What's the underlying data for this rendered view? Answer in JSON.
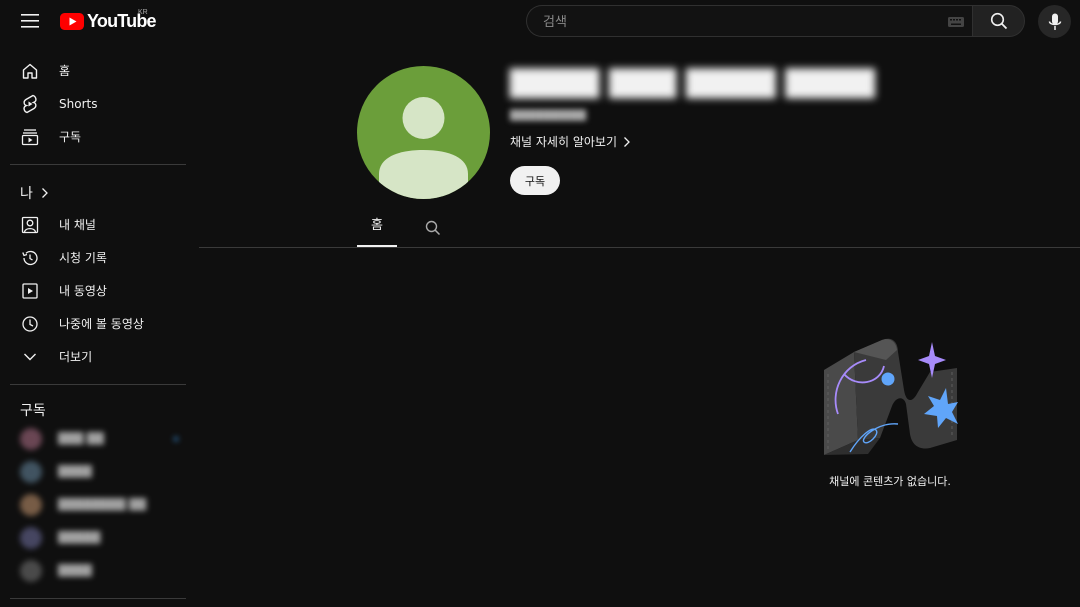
{
  "header": {
    "logo_text": "YouTube",
    "region": "KR",
    "search_placeholder": "검색"
  },
  "sidebar": {
    "main_items": [
      {
        "label": "홈",
        "icon": "home-icon"
      },
      {
        "label": "Shorts",
        "icon": "shorts-icon"
      },
      {
        "label": "구독",
        "icon": "subscriptions-icon"
      }
    ],
    "me_title": "나",
    "me_items": [
      {
        "label": "내 채널",
        "icon": "your-channel-icon"
      },
      {
        "label": "시청 기록",
        "icon": "history-icon"
      },
      {
        "label": "내 동영상",
        "icon": "your-videos-icon"
      },
      {
        "label": "나중에 볼 동영상",
        "icon": "watch-later-icon"
      },
      {
        "label": "더보기",
        "icon": "chevron-down-icon"
      }
    ],
    "subscriptions_title": "구독",
    "subscriptions": [
      {
        "name": "███ ██",
        "color": "#7a5060"
      },
      {
        "name": "████",
        "color": "#4a6070"
      },
      {
        "name": "████████ ██",
        "color": "#8a6a50"
      },
      {
        "name": "█████",
        "color": "#505070"
      },
      {
        "name": "████",
        "color": "#555555"
      }
    ]
  },
  "channel": {
    "name": "▇▇▇▇ ▇▇▇ ▇▇▇▇ ▇▇▇▇",
    "handle": "▇▇▇▇▇▇▇▇▇",
    "more_link": "채널 자세히 알아보기",
    "subscribe_label": "구독",
    "avatar_color": "#6b9e3a",
    "tabs": [
      {
        "label": "홈"
      }
    ]
  },
  "empty_state": {
    "message": "채널에 콘텐츠가 없습니다."
  },
  "colors": {
    "background": "#0f0f0f",
    "brand_red": "#ff0000",
    "accent_purple": "#a78bfa",
    "accent_blue": "#60a5fa"
  }
}
